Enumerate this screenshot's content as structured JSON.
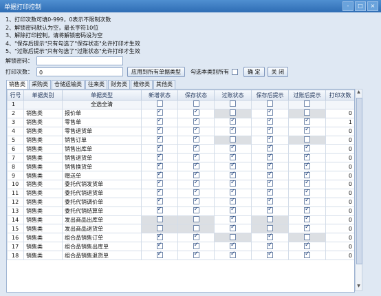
{
  "window": {
    "title": "单据打印控制",
    "controls": [
      "-",
      "□",
      "×"
    ]
  },
  "notes": [
    "1、打印次数可填0-999，0表示不限制次数",
    "2、解锁密码默认为空，最长字符10位",
    "3、解除打印控制，请将解锁密码设为空",
    "4、\"保存后提示\"只有勾选了\"保存状态\"允许打印才生效",
    "5、\"过账后提示\"只有勾选了\"过账状态\"允许打印才生效"
  ],
  "form": {
    "password_label": "解锁密码：",
    "password_value": "",
    "print_count_label": "打印次数：",
    "print_count_value": "0",
    "apply_all_button": "应用到所有单据类型",
    "check_all_label": "勾选本类别所有",
    "ok_button": "确 定",
    "close_button": "关 闭"
  },
  "tabs": [
    "销售类",
    "采购类",
    "仓储运输类",
    "往来类",
    "财务类",
    "维修类",
    "其他类"
  ],
  "table": {
    "columns": [
      "行号",
      "单据类别",
      "单据类型",
      "新增状态",
      "保存状态",
      "过账状态",
      "保存后提示",
      "过账后提示",
      "打印次数"
    ],
    "rows": [
      {
        "no": "1",
        "cat": "",
        "type": "全选全清",
        "c": [
          false,
          false,
          false,
          false,
          false
        ],
        "g": [],
        "count": ""
      },
      {
        "no": "2",
        "cat": "销售类",
        "type": "报价单",
        "c": [
          true,
          true,
          false,
          true,
          false
        ],
        "g": [
          2,
          4
        ],
        "count": "0"
      },
      {
        "no": "3",
        "cat": "销售类",
        "type": "零售单",
        "c": [
          true,
          true,
          true,
          true,
          true
        ],
        "g": [],
        "count": "1"
      },
      {
        "no": "4",
        "cat": "销售类",
        "type": "零售退货单",
        "c": [
          true,
          true,
          true,
          true,
          true
        ],
        "g": [],
        "count": "0"
      },
      {
        "no": "5",
        "cat": "销售类",
        "type": "销售订单",
        "c": [
          true,
          true,
          false,
          true,
          false
        ],
        "g": [
          2,
          4
        ],
        "count": "0"
      },
      {
        "no": "6",
        "cat": "销售类",
        "type": "销售出库单",
        "c": [
          true,
          true,
          true,
          true,
          true
        ],
        "g": [],
        "count": "0"
      },
      {
        "no": "7",
        "cat": "销售类",
        "type": "销售退货单",
        "c": [
          true,
          true,
          true,
          true,
          true
        ],
        "g": [],
        "count": "0"
      },
      {
        "no": "8",
        "cat": "销售类",
        "type": "销售换货单",
        "c": [
          true,
          true,
          true,
          true,
          true
        ],
        "g": [],
        "count": "0"
      },
      {
        "no": "9",
        "cat": "销售类",
        "type": "赠送单",
        "c": [
          true,
          true,
          true,
          true,
          true
        ],
        "g": [],
        "count": "0"
      },
      {
        "no": "10",
        "cat": "销售类",
        "type": "委托代销发货单",
        "c": [
          true,
          true,
          true,
          true,
          true
        ],
        "g": [],
        "count": "0"
      },
      {
        "no": "11",
        "cat": "销售类",
        "type": "委托代销退货单",
        "c": [
          true,
          true,
          true,
          true,
          true
        ],
        "g": [],
        "count": "0"
      },
      {
        "no": "12",
        "cat": "销售类",
        "type": "委托代销调价单",
        "c": [
          true,
          true,
          true,
          true,
          true
        ],
        "g": [],
        "count": "0"
      },
      {
        "no": "13",
        "cat": "销售类",
        "type": "委托代销结算单",
        "c": [
          true,
          true,
          true,
          true,
          true
        ],
        "g": [],
        "count": "0"
      },
      {
        "no": "14",
        "cat": "销售类",
        "type": "发出商品出库单",
        "c": [
          false,
          false,
          true,
          false,
          true
        ],
        "g": [
          0,
          1,
          3
        ],
        "count": "0"
      },
      {
        "no": "15",
        "cat": "销售类",
        "type": "发出商品退货单",
        "c": [
          false,
          false,
          true,
          false,
          true
        ],
        "g": [
          0,
          1,
          3
        ],
        "count": "0"
      },
      {
        "no": "16",
        "cat": "销售类",
        "type": "组合品销售订单",
        "c": [
          true,
          true,
          false,
          true,
          false
        ],
        "g": [
          2,
          4
        ],
        "count": "0"
      },
      {
        "no": "17",
        "cat": "销售类",
        "type": "组合品销售出库单",
        "c": [
          true,
          true,
          true,
          true,
          true
        ],
        "g": [],
        "count": "0"
      },
      {
        "no": "18",
        "cat": "销售类",
        "type": "组合品销售退货单",
        "c": [
          true,
          true,
          true,
          true,
          true
        ],
        "g": [],
        "count": "0"
      }
    ]
  }
}
